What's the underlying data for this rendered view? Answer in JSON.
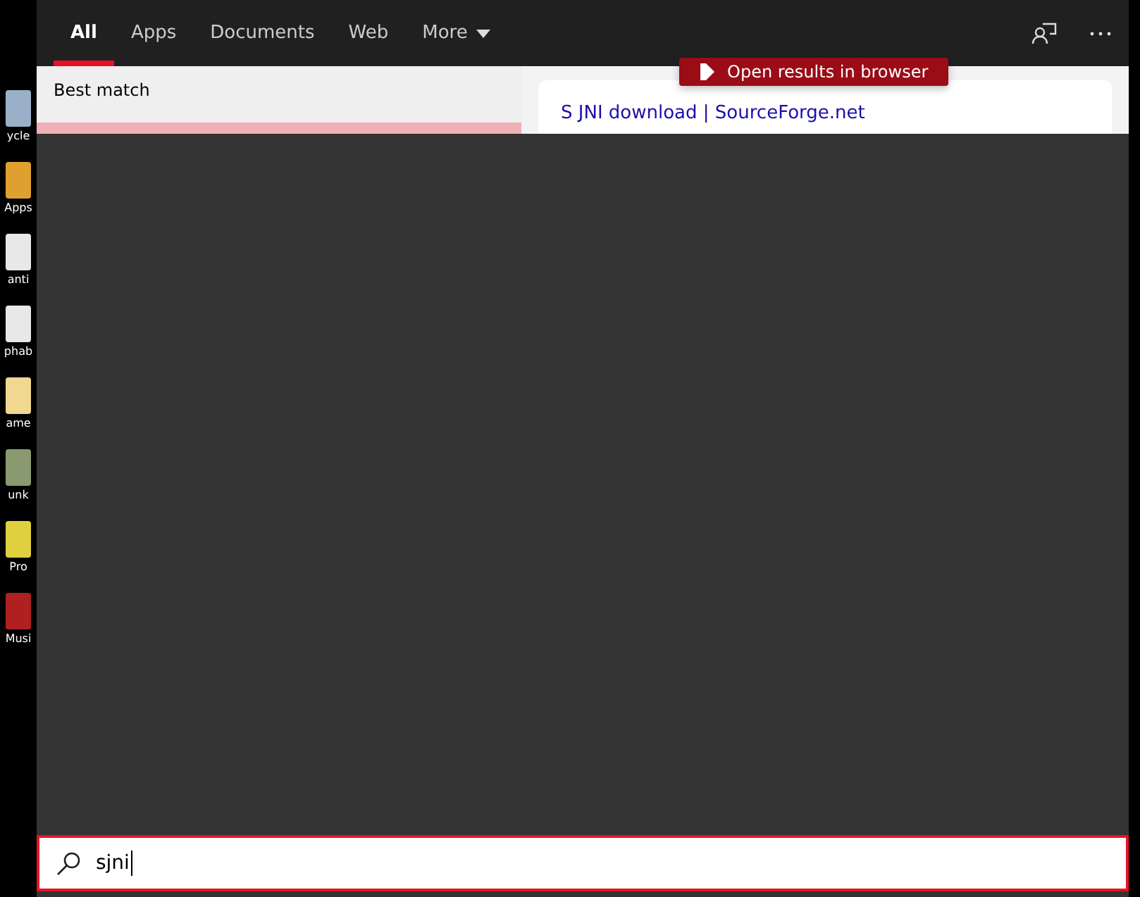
{
  "desktop_icons": [
    {
      "label": "ycle",
      "color": "#9ab0c8"
    },
    {
      "label": "Apps",
      "color": "#e0a030"
    },
    {
      "label": "anti",
      "color": "#e8e8e8"
    },
    {
      "label": "phab",
      "color": "#e8e8e8"
    },
    {
      "label": "ame",
      "color": "#f0d890"
    },
    {
      "label": "unk",
      "color": "#8a9a70"
    },
    {
      "label": "Pro",
      "color": "#e0d040"
    },
    {
      "label": "Musi",
      "color": "#b02020"
    }
  ],
  "tabs": [
    {
      "label": "All",
      "selected": true
    },
    {
      "label": "Apps",
      "selected": false
    },
    {
      "label": "Documents",
      "selected": false
    },
    {
      "label": "Web",
      "selected": false
    },
    {
      "label": "More",
      "selected": false,
      "dropdown": true
    }
  ],
  "best_match": {
    "heading": "Best match"
  },
  "web_preview": {
    "button": "Open results in browser",
    "link": "S JNI download | SourceForge.net"
  },
  "search": {
    "value": "sjni"
  }
}
